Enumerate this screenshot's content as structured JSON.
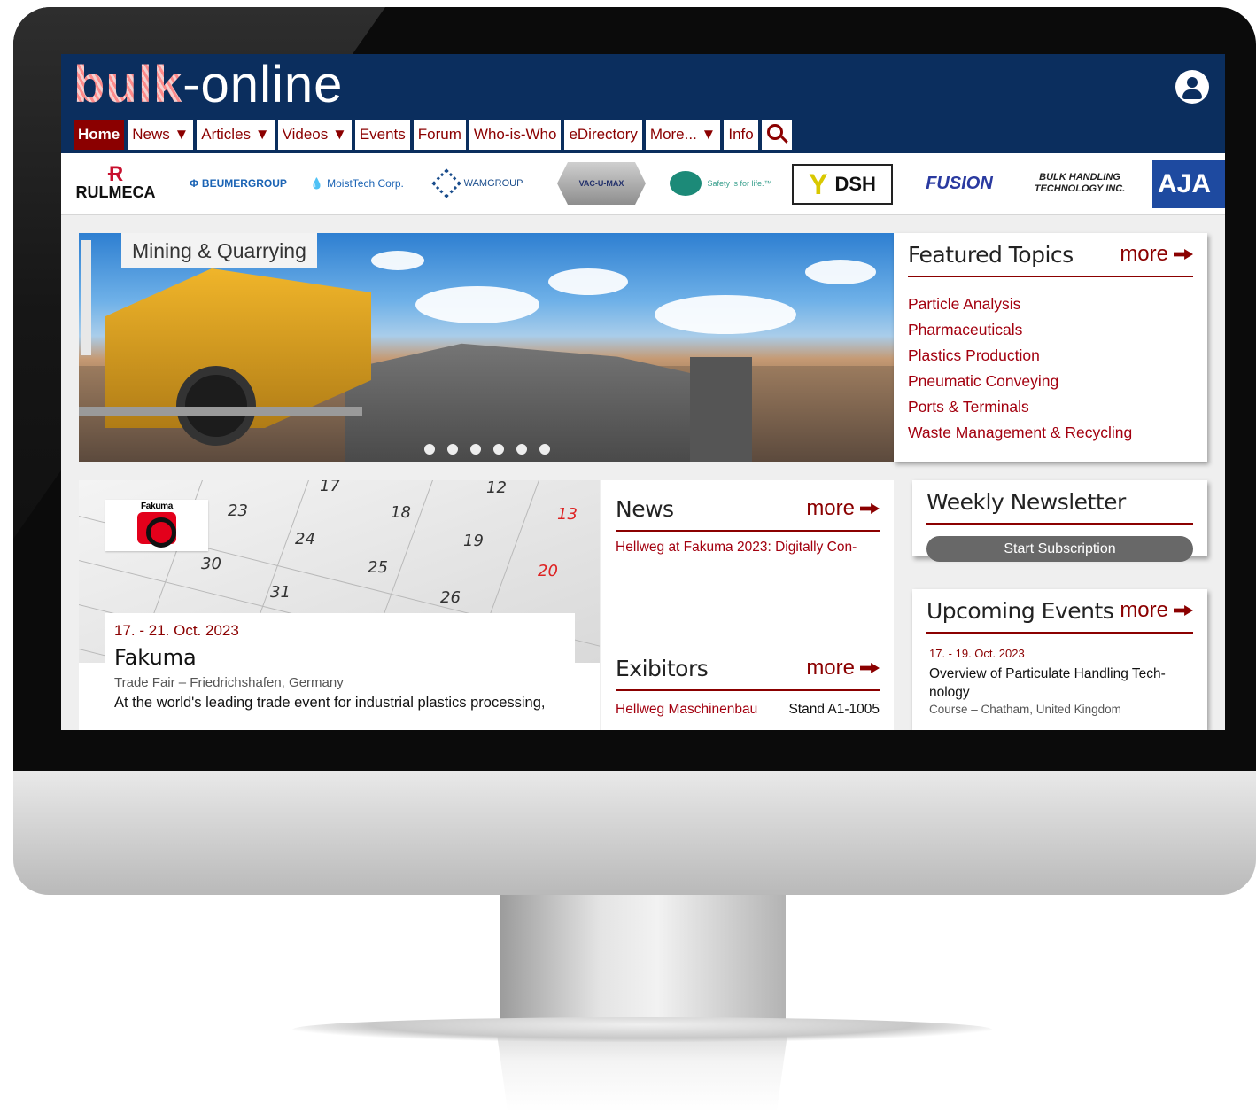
{
  "site": {
    "logo_bold": "bulk",
    "logo_light": "-online"
  },
  "nav": {
    "items": [
      {
        "label": "Home"
      },
      {
        "label": "News ▼"
      },
      {
        "label": "Articles ▼"
      },
      {
        "label": "Videos ▼"
      },
      {
        "label": "Events"
      },
      {
        "label": "Forum"
      },
      {
        "label": "Who-is-Who"
      },
      {
        "label": "eDirectory"
      },
      {
        "label": "More... ▼"
      },
      {
        "label": "Info"
      }
    ],
    "active_index": 0,
    "search_icon": "search-icon",
    "user_icon": "user-icon"
  },
  "sponsors": {
    "rulmeca": "RULMECA",
    "beumer": "BEUMERGROUP",
    "moisttech": "MoistTech Corp.",
    "wam": "WAMGROUP",
    "vacumax": "VAC-U-MAX",
    "safety": "Safety is for life.™",
    "dsh": "DSH",
    "fusion": "FUSION",
    "bht_line1": "BULK HANDLING",
    "bht_line2": "TECHNOLOGY INC.",
    "aja": "AJA"
  },
  "hero": {
    "tag": "Mining & Quarrying",
    "slide_count": 6
  },
  "featured_topics": {
    "title": "Featured Topics",
    "more": "more",
    "items": [
      "Particle Analysis",
      "Pharmaceuticals",
      "Plastics Production",
      "Pneumatic Conveying",
      "Ports & Terminals",
      "Waste Management & Recycling"
    ]
  },
  "event_card": {
    "logo_text": "Fakuma",
    "date": "17. - 21. Oct. 2023",
    "title": "Fakuma",
    "subtitle": "Trade Fair – Friedrichshafen, Germany",
    "description": "At the world's leading trade event for industrial plastics processing,",
    "calendar_numbers": [
      "23",
      "17",
      "18",
      "12",
      "13",
      "24",
      "19",
      "30",
      "25",
      "20",
      "31",
      "26"
    ]
  },
  "news": {
    "title": "News",
    "more": "more",
    "item": "Hellweg at Fakuma 2023: Digitally Con-"
  },
  "exhibitors": {
    "title": "Exibitors",
    "more": "more",
    "name": "Hellweg Maschinenbau",
    "stand": "Stand A1-1005"
  },
  "newsletter": {
    "title": "Weekly Newsletter",
    "button": "Start Subscription"
  },
  "upcoming_events": {
    "title": "Upcoming Events",
    "more": "more",
    "date": "17. - 19. Oct. 2023",
    "event_title": "Overview of Particulate Handling Tech- nology",
    "event_sub": "Course – Chatham, United Kingdom"
  }
}
